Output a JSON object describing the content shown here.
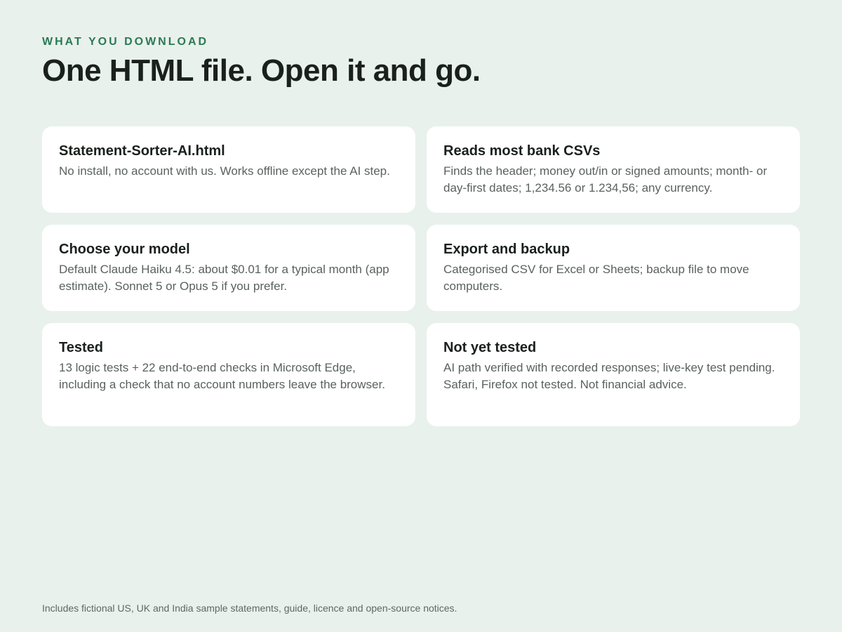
{
  "eyebrow": "WHAT YOU DOWNLOAD",
  "headline": "One HTML file. Open it and go.",
  "cards": [
    {
      "title": "Statement-Sorter-AI.html",
      "body": "No install, no account with us. Works offline except the AI step."
    },
    {
      "title": "Reads most bank CSVs",
      "body": "Finds the header; money out/in or signed amounts; month- or day-first dates; 1,234.56 or 1.234,56; any currency."
    },
    {
      "title": "Choose your model",
      "body": "Default Claude Haiku 4.5: about $0.01 for a typical month (app estimate). Sonnet 5 or Opus 5 if you prefer."
    },
    {
      "title": "Export and backup",
      "body": "Categorised CSV for Excel or Sheets; backup file to move computers."
    },
    {
      "title": "Tested",
      "body": "13 logic tests + 22 end-to-end checks in Microsoft Edge, including a check that no account numbers leave the browser."
    },
    {
      "title": "Not yet tested",
      "body": "AI path verified with recorded responses; live-key test pending. Safari, Firefox not tested. Not financial advice."
    }
  ],
  "footer": "Includes fictional US, UK and India sample statements, guide, licence and open-source notices.",
  "colors": {
    "background": "#e9f1ec",
    "accent": "#2a7a55",
    "card": "#ffffff",
    "heading": "#1a201c",
    "body_text": "#59625c"
  }
}
